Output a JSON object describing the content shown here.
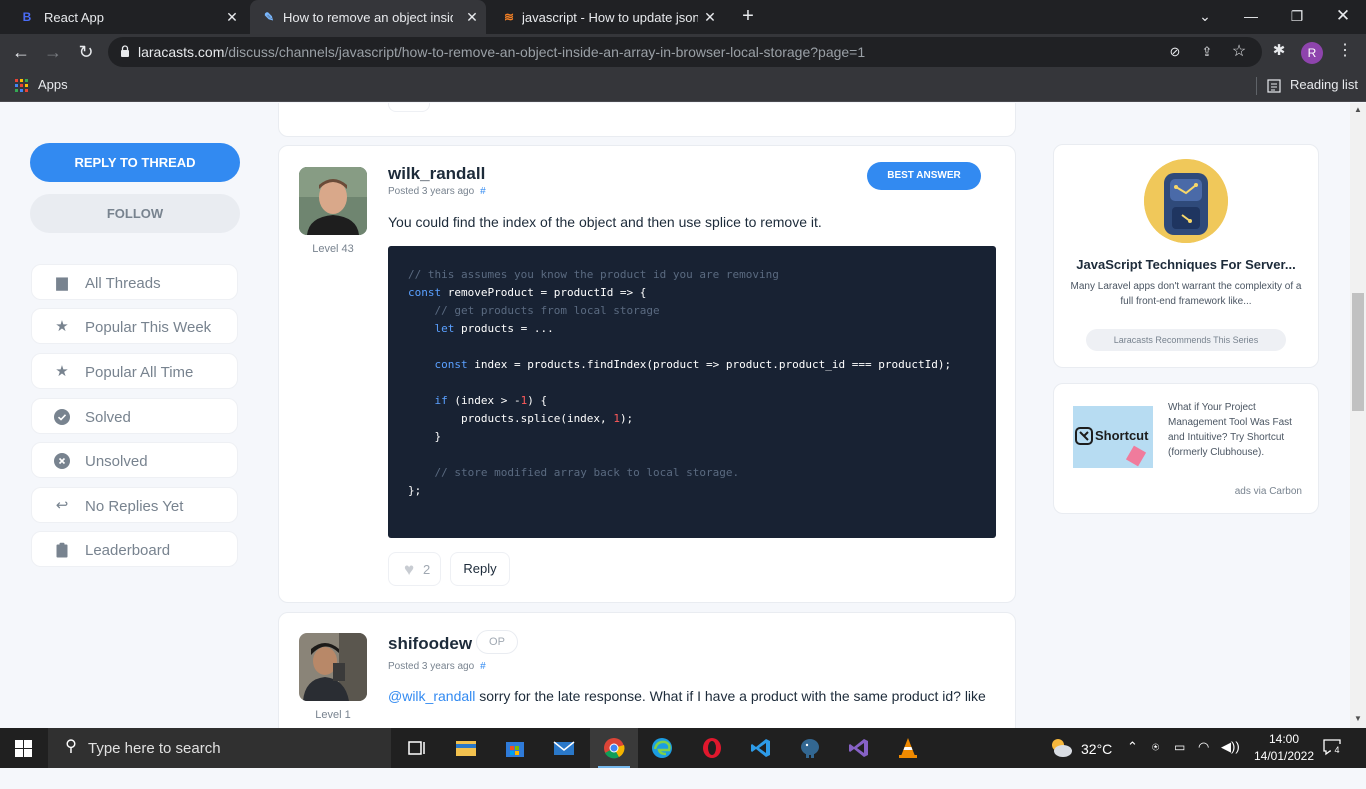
{
  "browser": {
    "tabs": [
      {
        "title": "React App",
        "favicon": "B"
      },
      {
        "title": "How to remove an object inside a",
        "favicon": "~"
      },
      {
        "title": "javascript - How to update json v",
        "favicon": "S"
      }
    ],
    "new_tab": "+",
    "url_host": "laracasts.com",
    "url_path": "/discuss/channels/javascript/how-to-remove-an-object-inside-an-array-in-browser-local-storage?page=1",
    "profile_initial": "R",
    "bookmarks_apps": "Apps",
    "reading_list": "Reading list"
  },
  "sidebar": {
    "reply_button": "REPLY TO THREAD",
    "follow_button": "FOLLOW",
    "items": [
      {
        "label": "All Threads",
        "icon": "threads-icon"
      },
      {
        "label": "Popular This Week",
        "icon": "star-icon"
      },
      {
        "label": "Popular All Time",
        "icon": "star-icon"
      },
      {
        "label": "Solved",
        "icon": "check-circle-icon"
      },
      {
        "label": "Unsolved",
        "icon": "x-circle-icon"
      },
      {
        "label": "No Replies Yet",
        "icon": "reply-icon"
      },
      {
        "label": "Leaderboard",
        "icon": "clipboard-icon"
      }
    ]
  },
  "posts": [
    {
      "username": "wilk_randall",
      "level": "Level 43",
      "posted": "Posted 3 years ago",
      "hash": "#",
      "best_answer": "BEST ANSWER",
      "body": "You could find the index of the object and then use splice to remove it.",
      "likes": "2",
      "reply": "Reply"
    },
    {
      "username": "shifoodew",
      "badge": "OP",
      "level": "Level 1",
      "posted": "Posted 3 years ago",
      "hash": "#",
      "mention": "@wilk_randall",
      "body": " sorry for the late response. What if I have a product with the same product id? like"
    }
  ],
  "series": {
    "title": "JavaScript Techniques For Server...",
    "description": "Many Laravel apps don't warrant the complexity of a full front-end framework like...",
    "recommend": "Laracasts Recommends This Series"
  },
  "ad": {
    "brand": "Shortcut",
    "text": "What if Your Project Management Tool Was Fast and Intuitive? Try Shortcut (formerly Clubhouse).",
    "via": "ads via Carbon"
  },
  "taskbar": {
    "search_placeholder": "Type here to search",
    "weather": "32°C",
    "time": "14:00",
    "date": "14/01/2022",
    "notifications": "4"
  },
  "colors": {
    "accent": "#328af1",
    "code_bg": "#182233",
    "page_bg": "#f5f7fb"
  }
}
